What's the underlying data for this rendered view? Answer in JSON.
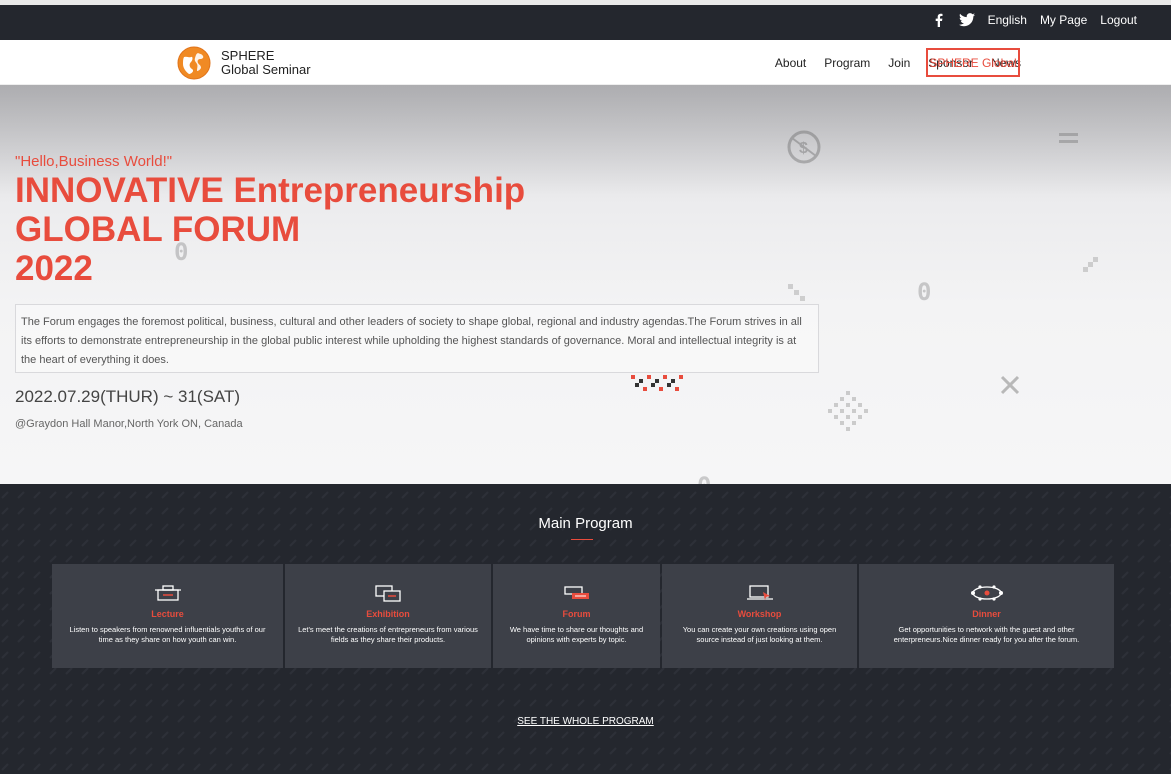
{
  "topbar": {
    "language": "English",
    "mypage": "My Page",
    "logout": "Logout"
  },
  "header": {
    "brand_line1": "SPHERE",
    "brand_line2": "Global Seminar",
    "nav": [
      "About",
      "Program",
      "Join",
      "Sponsor",
      "News"
    ],
    "highlight_button": "SPHERE Global"
  },
  "hero": {
    "hello": "\"Hello,Business World!\"",
    "title_line1": "INNOVATIVE Entrepreneurship",
    "title_line2": "GLOBAL FORUM",
    "title_line3": "2022",
    "description": "The Forum engages the foremost political, business, cultural and other leaders of society to shape global, regional and industry agendas.The Forum strives in all its efforts to demonstrate entrepreneurship in the global public interest while upholding the highest standards of governance. Moral and intellectual integrity is at the heart of everything it does.",
    "date": "2022.07.29(THUR) ~ 31(SAT)",
    "venue": "@Graydon Hall Manor,North York ON, Canada"
  },
  "program": {
    "title": "Main Program",
    "cards": [
      {
        "name": "Lecture",
        "desc": "Listen to speakers from renowned influentials youths of our time as they share on how youth can win.",
        "icon": "lecture-icon"
      },
      {
        "name": "Exhibition",
        "desc": "Let's meet the creations of entrepreneurs from various fields as they share their products.",
        "icon": "exhibition-icon"
      },
      {
        "name": "Forum",
        "desc": "We have time to share our thoughts and opinions with experts by topic.",
        "icon": "forum-icon"
      },
      {
        "name": "Workshop",
        "desc": "You can create your own creations using open source instead of just looking at them.",
        "icon": "workshop-icon"
      },
      {
        "name": "Dinner",
        "desc": "Get opportunities to network with the guest and other enterpreneurs.Nice dinner ready for you after the forum.",
        "icon": "dinner-icon"
      }
    ],
    "see_all": "SEE THE WHOLE PROGRAM"
  },
  "colors": {
    "accent": "#e84c3d",
    "dark": "#24272e",
    "card": "#3d4048"
  }
}
